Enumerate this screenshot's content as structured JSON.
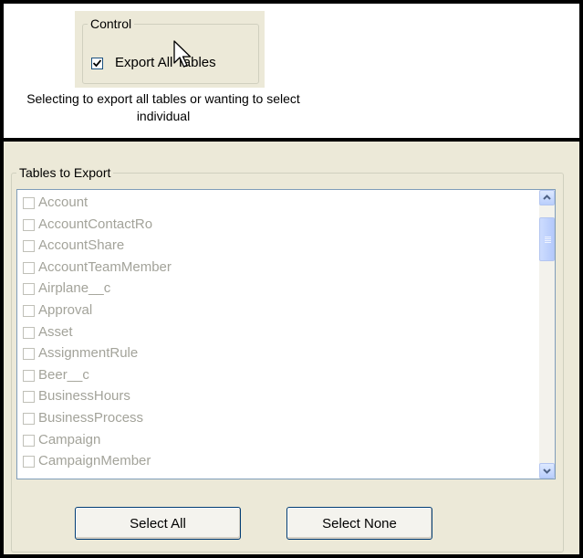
{
  "control": {
    "group_title": "Control",
    "export_all_label": "Export All Tables",
    "export_all_checked": true
  },
  "caption": "Selecting to export all tables or wanting to select individual",
  "tables": {
    "group_title": "Tables to Export",
    "items": [
      "Account",
      "AccountContactRo",
      "AccountShare",
      "AccountTeamMember",
      "Airplane__c",
      "Approval",
      "Asset",
      "AssignmentRule",
      "Beer__c",
      "BusinessHours",
      "BusinessProcess",
      "Campaign",
      "CampaignMember"
    ]
  },
  "buttons": {
    "select_all": "Select All",
    "select_none": "Select None"
  }
}
